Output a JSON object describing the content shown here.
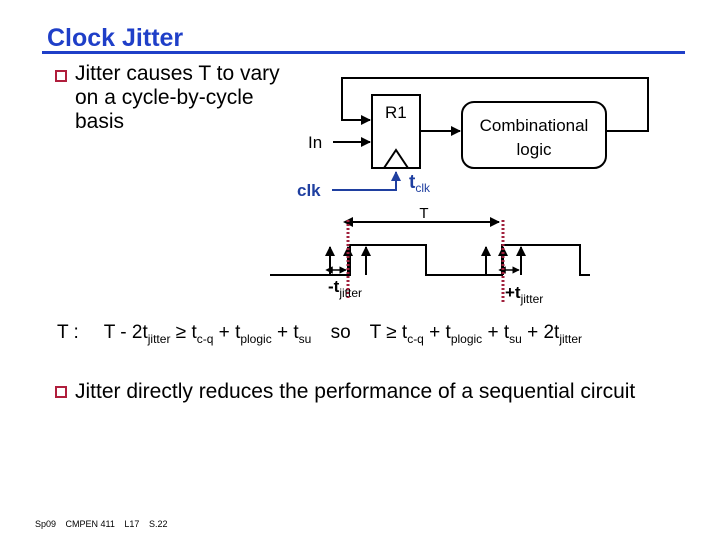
{
  "slide": {
    "title": "Clock Jitter",
    "bullets": [
      {
        "icon": "square-bullet-icon",
        "text": "Jitter causes T to vary on a cycle-by-cycle basis"
      },
      {
        "icon": "square-bullet-icon",
        "text": "Jitter directly reduces the performance of a sequential circuit"
      }
    ],
    "colors": {
      "title": "#1f3fc8",
      "bullet": "#b01e3c",
      "clock_wire": "#1f3fa0",
      "jitter_marker": "#a0203c"
    }
  },
  "diagram": {
    "register_label": "R1",
    "logic_label_line1": "Combinational",
    "logic_label_line2": "logic",
    "input_label": "In",
    "clock_label": "clk",
    "clock_delay_label": "t",
    "clock_delay_sub": "clk",
    "period_label": "T",
    "neg_jitter_label": "-t",
    "neg_jitter_sub": "jitter",
    "pos_jitter_label": "+t",
    "pos_jitter_sub": "jitter"
  },
  "equation": {
    "lead": "T :",
    "lhs_1": "T - 2t",
    "lhs_1_sub": "jitter",
    "ge": "≥",
    "t": "t",
    "cq_sub": "c-q",
    "plus": "+",
    "plogic_sub": "plogic",
    "su_sub": "su",
    "so": "so",
    "T": "T",
    "two_t": "2t",
    "jitter_sub": "jitter"
  },
  "footer": {
    "term": "Sp09",
    "course": "CMPEN 411",
    "lecture": "L17",
    "slide": "S.22"
  }
}
